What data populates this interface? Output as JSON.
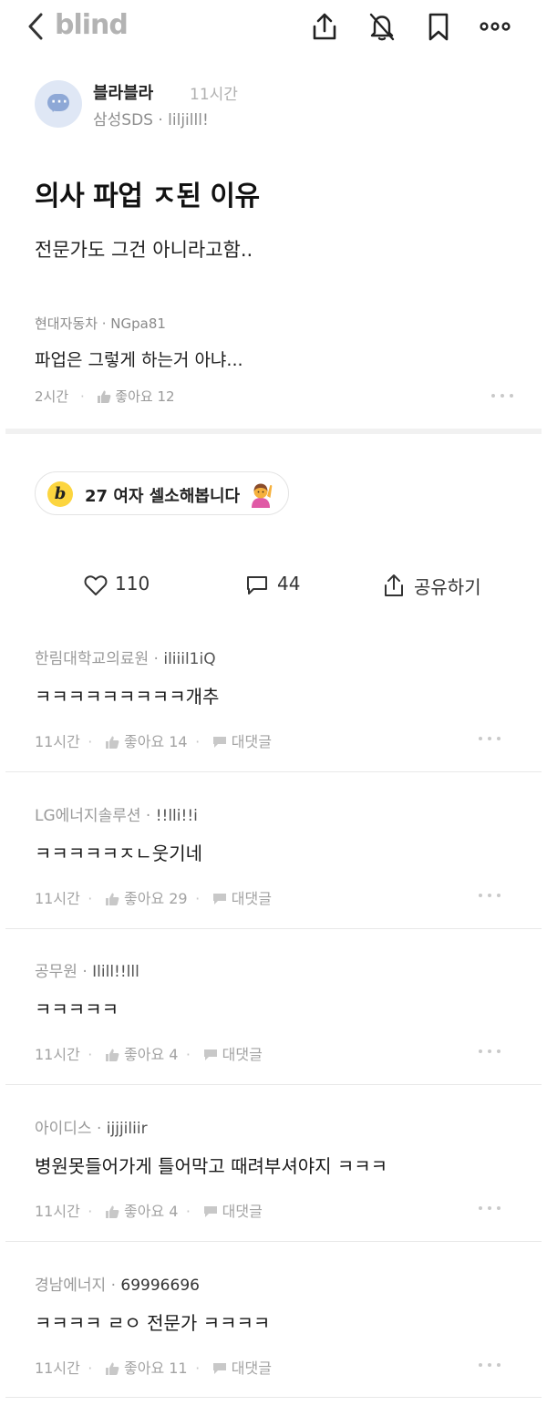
{
  "header": {
    "logo": "blind",
    "back_icon": "chevron-left-icon",
    "share_icon": "share-icon",
    "mute_icon": "bell-off-icon",
    "bookmark_icon": "bookmark-icon",
    "more_icon": "more-icon"
  },
  "post": {
    "author_name": "블라블라",
    "time": "11시간",
    "company": "삼성SDS · liljilll!",
    "title": "의사 파업 ㅈ된 이유",
    "body": "전문가도 그건 아니라고함.."
  },
  "best_comment": {
    "meta": "현대자동차 · NGpa81",
    "text": "파업은 그렇게 하는거 아냐...",
    "time": "2시간",
    "likes": "좋아요 12"
  },
  "promo": {
    "badge": "b",
    "text": "27 여자 셀소해봅니다"
  },
  "actions": {
    "likes": "110",
    "comments": "44",
    "share": "공유하기"
  },
  "comments": [
    {
      "company": "한림대학교의료원",
      "nick": "iliiil1iQ",
      "text": "ㅋㅋㅋㅋㅋㅋㅋㅋㅋ개추",
      "time": "11시간",
      "likes": "좋아요 14",
      "reply": "대댓글"
    },
    {
      "company": "LG에너지솔루션",
      "nick": "!!lli!!i",
      "text": "ㅋㅋㅋㅋㅋㅈㄴ웃기네",
      "time": "11시간",
      "likes": "좋아요 29",
      "reply": "대댓글"
    },
    {
      "company": "공무원",
      "nick": "Ilill!!lll",
      "text": "ㅋㅋㅋㅋㅋ",
      "time": "11시간",
      "likes": "좋아요 4",
      "reply": "대댓글"
    },
    {
      "company": "아이디스",
      "nick": "ijjjiliir",
      "text": "병원못들어가게 틀어막고 때려부셔야지 ㅋㅋㅋ",
      "time": "11시간",
      "likes": "좋아요 4",
      "reply": "대댓글"
    },
    {
      "company": "경남에너지",
      "nick": "69996696",
      "text": "ㅋㅋㅋㅋ ㄹㅇ 전문가 ㅋㅋㅋㅋ",
      "time": "11시간",
      "likes": "좋아요 11",
      "reply": "대댓글"
    }
  ]
}
